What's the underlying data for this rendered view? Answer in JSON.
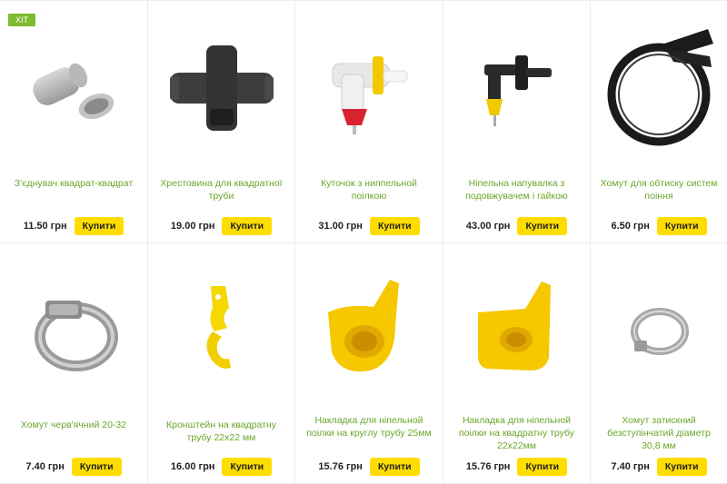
{
  "products": [
    {
      "badge": "ХІТ",
      "title": "З'єднувач квадрат-квадрат",
      "price": "11.50 грн",
      "buy_label": "Купити",
      "icon": "connector-square"
    },
    {
      "title": "Хрестовина для квадратної труби",
      "price": "19.00 грн",
      "buy_label": "Купити",
      "icon": "cross-fitting"
    },
    {
      "title": "Куточок з ниппельной поілкою",
      "price": "31.00 грн",
      "buy_label": "Купити",
      "icon": "corner-nipple-drinker"
    },
    {
      "title": "Нiпельна напувалка з подовжувачем і гайкою",
      "price": "43.00 грн",
      "buy_label": "Купити",
      "icon": "nipple-drinker"
    },
    {
      "title": "Хомут для обтиску систем поіння",
      "price": "6.50 грн",
      "buy_label": "Купити",
      "icon": "plastic-clamp"
    },
    {
      "title": "Хомут черв'ячний 20-32",
      "price": "7.40 грн",
      "buy_label": "Купити",
      "icon": "worm-clamp"
    },
    {
      "title": "Кронштейн на квадратну трубу 22х22 мм",
      "price": "16.00 грн",
      "buy_label": "Купити",
      "icon": "yellow-bracket"
    },
    {
      "title": "Накладка для нiпельной поілки на круглу трубу 25мм",
      "price": "15.76 грн",
      "buy_label": "Купити",
      "icon": "yellow-cover-round"
    },
    {
      "title": "Накладка для нiпельной поілки на квадратну трубу 22х22мм",
      "price": "15.76 грн",
      "buy_label": "Купити",
      "icon": "yellow-cover-square"
    },
    {
      "title": "Хомут затискний безступінчатий діаметр 30,8 мм",
      "price": "7.40 грн",
      "buy_label": "Купити",
      "icon": "stepless-clamp"
    }
  ],
  "colors": {
    "title_green": "#6aa62a",
    "buy_yellow": "#ffdd00",
    "badge_green": "#7dbb2f"
  }
}
